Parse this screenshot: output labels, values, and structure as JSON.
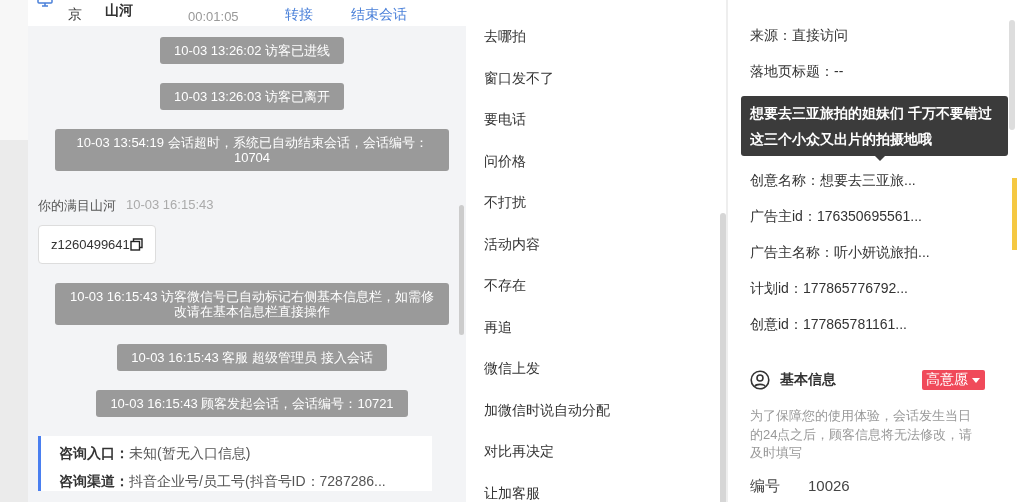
{
  "chat": {
    "header": {
      "location": "京",
      "name": "山河",
      "timer": "00:01:05",
      "actions": [
        "转接",
        "结束会话"
      ]
    },
    "messages": [
      {
        "kind": "notice",
        "text": "10-03 13:26:02 访客已进线"
      },
      {
        "kind": "notice",
        "text": "10-03 13:26:03 访客已离开"
      },
      {
        "kind": "notice",
        "text": "10-03 13:54:19 会话超时，系统已自动结束会话，会话编号：10704"
      },
      {
        "kind": "visitor",
        "sender": "你的满目山河",
        "time": "10-03 16:15:43",
        "text": "z1260499641"
      },
      {
        "kind": "notice",
        "text": "10-03 16:15:43 访客微信号已自动标记右侧基本信息栏，如需修改请在基本信息栏直接操作"
      },
      {
        "kind": "notice",
        "text": "10-03 16:15:43 客服 超级管理员 接入会话"
      },
      {
        "kind": "notice",
        "text": "10-03 16:15:43 顾客发起会话，会话编号：10721"
      }
    ],
    "info_card": {
      "lines": [
        "**咨询入口：**未知(暂无入口信息)",
        "**咨询渠道：**抖音企业号/员工号(抖音号ID：7287286..."
      ]
    }
  },
  "quick_replies": [
    "去哪拍",
    "窗口发不了",
    "要电话",
    "问价格",
    "不打扰",
    "活动内容",
    "不存在",
    "再追",
    "微信上发",
    "加微信时说自动分配",
    "对比再决定",
    "让加客服"
  ],
  "visitor_info": {
    "fields_top": [
      "来源：直接访问",
      "落地页标题：--"
    ],
    "fields": [
      "创意名称：想要去三亚旅...",
      "广告主id：176350695561...",
      "广告主名称：听小妍说旅拍...",
      "计划id：177865776792...",
      "创意id：177865781161..."
    ],
    "tooltip": "想要去三亚旅拍的姐妹们 千万不要错过这三个小众又出片的拍摄地哦",
    "basic_info": {
      "title": "基本信息",
      "intent": "高意愿",
      "notice": "为了保障您的使用体验，会话发生当日的24点之后，顾客信息将无法修改，请及时填写",
      "number_label": "编号",
      "number_value": "10026"
    }
  }
}
